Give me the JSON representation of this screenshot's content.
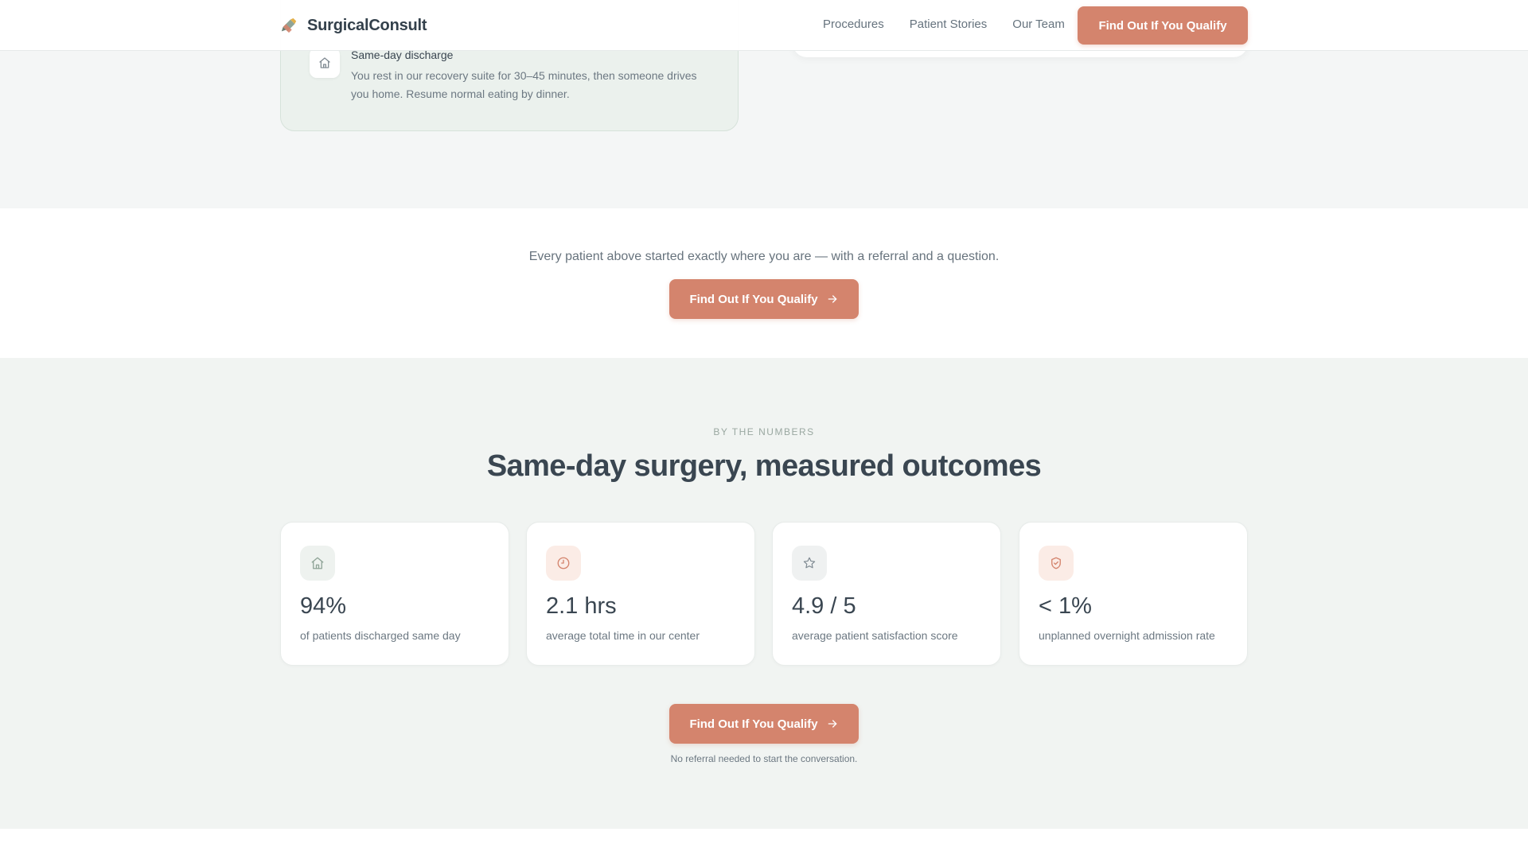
{
  "nav": {
    "brand": "SurgicalConsult",
    "links": [
      "Procedures",
      "Patient Stories",
      "Our Team"
    ],
    "cta": "Find Out If You Qualify"
  },
  "previous_section": {
    "card_title": "Same-day discharge",
    "card_text": "You rest in our recovery suite for 30–45 minutes, then someone drives you home. Resume normal eating by dinner.",
    "card_icon": "home-icon"
  },
  "referral": {
    "text": "Every patient above started exactly where you are — with a referral and a question.",
    "cta": "Find Out If You Qualify"
  },
  "numbers": {
    "eyebrow": "BY THE NUMBERS",
    "heading": "Same-day surgery, measured outcomes",
    "stats": [
      {
        "icon": "home-icon",
        "value": "94%",
        "label": "of patients discharged same day"
      },
      {
        "icon": "clock-icon",
        "value": "2.1 hrs",
        "label": "average total time in our center"
      },
      {
        "icon": "star-icon",
        "value": "4.9 / 5",
        "label": "average patient satisfaction score"
      },
      {
        "icon": "shield-check-icon",
        "value": "< 1%",
        "label": "unplanned overnight admission rate"
      }
    ],
    "cta": "Find Out If You Qualify",
    "note": "No referral needed to start the conversation."
  },
  "colors": {
    "accent": "#d4846d",
    "sage": "#8fa497",
    "text": "#3a4651"
  }
}
